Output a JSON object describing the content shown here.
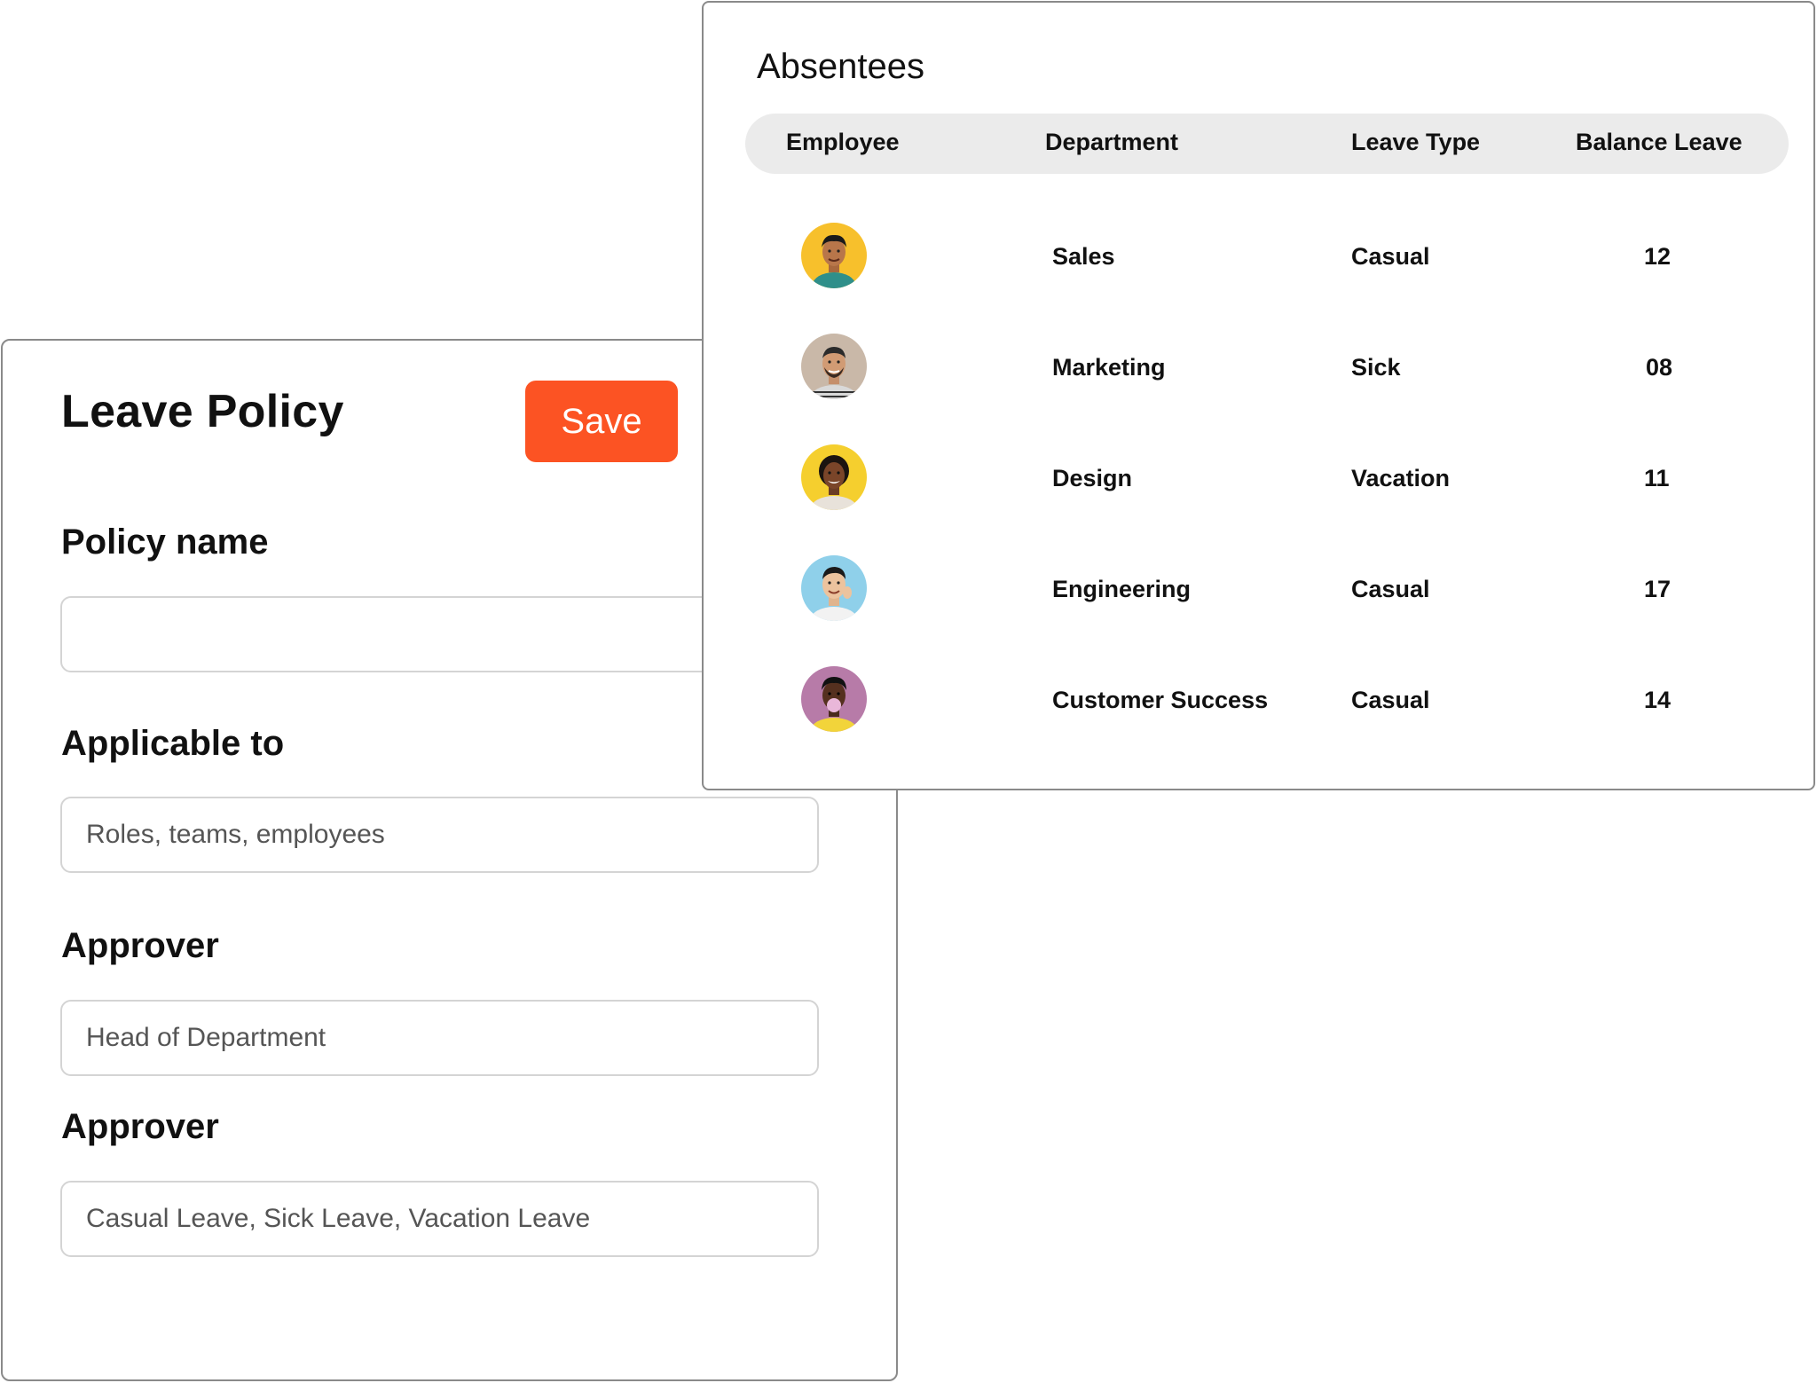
{
  "policy": {
    "title": "Leave Policy",
    "save_label": "Save",
    "fields": {
      "policy_name": {
        "label": "Policy name",
        "placeholder": ""
      },
      "applicable_to": {
        "label": "Applicable to",
        "placeholder": "Roles, teams, employees"
      },
      "approver": {
        "label": "Approver",
        "placeholder": "Head of Department"
      },
      "leave_types": {
        "label": "Approver",
        "placeholder": "Casual Leave, Sick Leave, Vacation Leave"
      }
    },
    "colors": {
      "accent": "#fc5323"
    }
  },
  "absentees": {
    "title": "Absentees",
    "columns": [
      "Employee",
      "Department",
      "Leave Type",
      "Balance Leave"
    ],
    "rows": [
      {
        "department": "Sales",
        "leave_type": "Casual",
        "balance": "12",
        "avatar_bg": "#f7c02c"
      },
      {
        "department": "Marketing",
        "leave_type": "Sick",
        "balance": "08",
        "avatar_bg": "#c9b8a8"
      },
      {
        "department": "Design",
        "leave_type": "Vacation",
        "balance": "11",
        "avatar_bg": "#f5cf2e"
      },
      {
        "department": "Engineering",
        "leave_type": "Casual",
        "balance": "17",
        "avatar_bg": "#8fd0ea"
      },
      {
        "department": "Customer Success",
        "leave_type": "Casual",
        "balance": "14",
        "avatar_bg": "#b77ba8"
      }
    ]
  }
}
